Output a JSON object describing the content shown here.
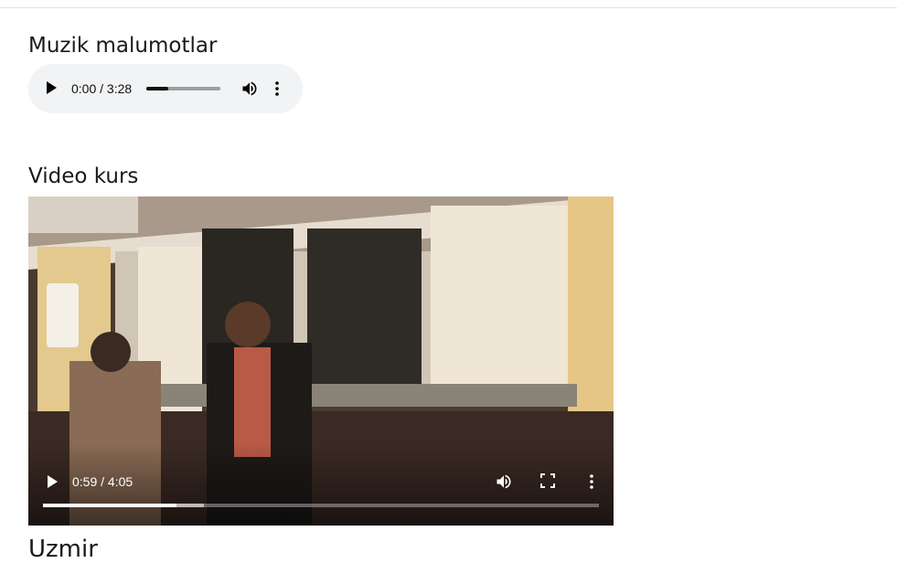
{
  "music": {
    "title": "Muzik malumotlar",
    "player": {
      "time": "0:00 / 3:28",
      "progress": 0.3
    }
  },
  "video": {
    "title": "Video kurs",
    "player": {
      "time": "0:59 / 4:05",
      "progress": 0.24,
      "buffered": 0.29
    }
  },
  "next_section": {
    "title": "Uzmir"
  },
  "icons": {
    "audio": [
      "play-icon",
      "volume-icon",
      "more-options-icon"
    ],
    "video": [
      "play-icon",
      "volume-icon",
      "fullscreen-icon",
      "more-options-icon"
    ]
  },
  "colors": {
    "player_bg": "#f1f3f4",
    "text": "#1a1a1a"
  }
}
